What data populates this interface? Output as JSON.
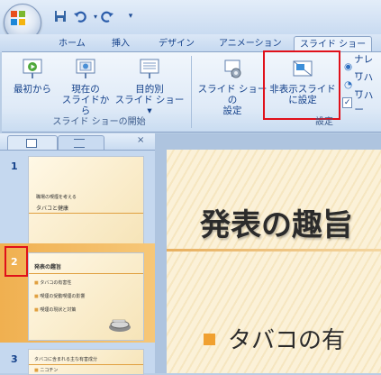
{
  "quick_access": {
    "icons": [
      "save-icon",
      "undo-icon",
      "redo-icon",
      "customize-qat-icon"
    ]
  },
  "tabs": [
    {
      "label": "ホーム"
    },
    {
      "label": "挿入"
    },
    {
      "label": "デザイン"
    },
    {
      "label": "アニメーション"
    },
    {
      "label": "スライド ショー",
      "active": true
    }
  ],
  "ribbon": {
    "group_start": {
      "label": "スライド ショーの開始",
      "buttons": [
        {
          "line1": "最初から",
          "line2": ""
        },
        {
          "line1": "現在の",
          "line2": "スライドから"
        },
        {
          "line1": "目的別",
          "line2": "スライド ショー ▾"
        }
      ]
    },
    "group_setup": {
      "label": "設定",
      "buttons": [
        {
          "line1": "スライド ショーの",
          "line2": "設定"
        },
        {
          "line1": "非表示スライド",
          "line2": "に設定"
        }
      ],
      "small_items": [
        "ナレー",
        "リハー",
        "リハー"
      ]
    }
  },
  "slides_pane": {
    "close_glyph": "×",
    "slides": [
      {
        "number": "1",
        "title": "職場の喫煙を考える",
        "subtitle": "タバコと健康"
      },
      {
        "number": "2",
        "title": "発表の趣旨",
        "bullets": [
          "タバコの有害性",
          "喫煙の受動喫煙の影響",
          "喫煙の現状と対策"
        ]
      },
      {
        "number": "3",
        "title": "タバコに含まれる主な有害成分",
        "bullets": [
          "ニコチン"
        ]
      }
    ]
  },
  "main_slide": {
    "title": "発表の趣旨",
    "bullet": "タバコの有"
  }
}
